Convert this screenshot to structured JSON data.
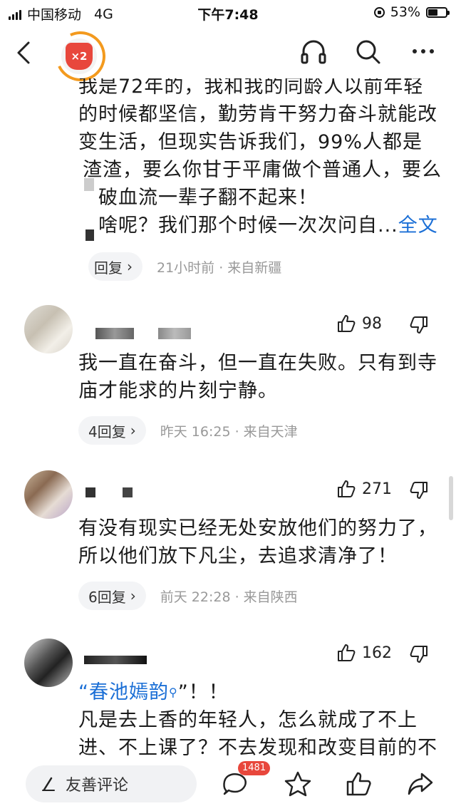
{
  "status_bar": {
    "carrier": "中国移动",
    "network": "4G",
    "time": "下午7:48",
    "battery": "53%",
    "battery_level": 0.53
  },
  "nav": {
    "badge_text": "×2",
    "icons": [
      "back-icon",
      "headphones-icon",
      "search-icon",
      "more-icon"
    ]
  },
  "comments": [
    {
      "lines": [
        "我是72年的，我和我的同龄人以前年轻",
        "的时候都坚信，勤劳肯干努力奋斗就能改",
        "变生活，但现实告诉我们，99%人都是",
        "渣渣，要么你甘于平庸做个普通人，要么",
        "破血流一辈子翻不起来！",
        "啥呢？我们那个时候一次次问自..."
      ],
      "full_text_link": "全文",
      "replies": "回复",
      "meta": "21小时前 · 来自新疆"
    },
    {
      "likes": "98",
      "lines": [
        "我一直在奋斗，但一直在失败。只有到寺",
        "庙才能求的片刻宁静。"
      ],
      "replies": "4回复",
      "meta": "昨天 16:25 · 来自天津"
    },
    {
      "likes": "271",
      "lines": [
        "有没有现实已经无处安放他们的努力了，",
        "所以他们放下凡尘，去追求清净了！"
      ],
      "replies": "6回复",
      "meta": "前天 22:28 · 来自陕西"
    },
    {
      "likes": "162",
      "quote_open": "“",
      "quote_link": "春池嫣韵",
      "quote_close": "”！！",
      "lines": [
        "凡是去上香的年轻人，怎么就成了不上",
        "进、不上课了？不去发现和改变目前的不"
      ]
    }
  ],
  "bottom_bar": {
    "input_placeholder": "友善评论",
    "comment_count": "1481",
    "icons": [
      "comment-icon",
      "star-icon",
      "thumbs-up-icon",
      "share-icon"
    ]
  },
  "colors": {
    "accent_blue": "#1b6fd6",
    "badge_red": "#e8473c",
    "ring_orange": "#f39a1e",
    "meta_gray": "#999999"
  }
}
